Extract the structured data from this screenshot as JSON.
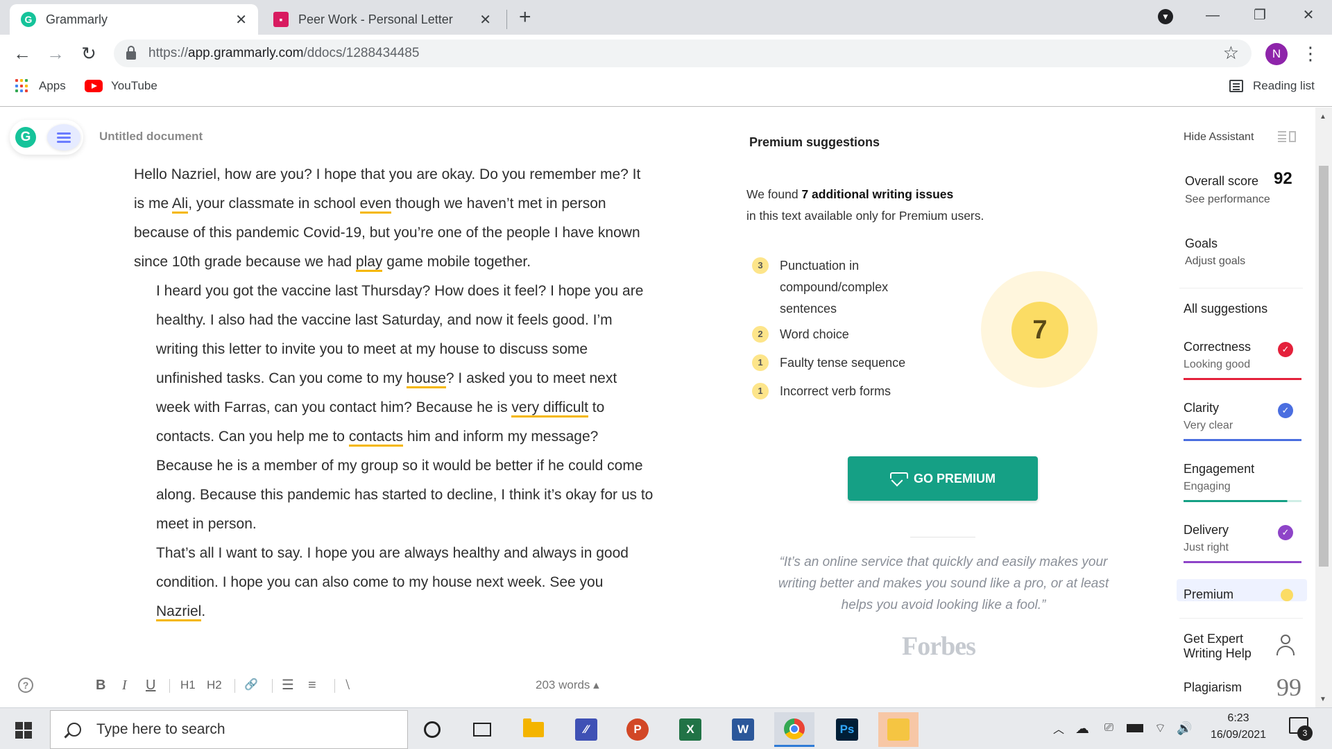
{
  "browser": {
    "tabs": [
      {
        "title": "Grammarly",
        "active": true
      },
      {
        "title": "Peer Work - Personal Letter",
        "active": false
      }
    ],
    "url_prefix": "https://",
    "url_host": "app.grammarly.com",
    "url_path": "/ddocs/1288434485",
    "profile_initial": "N",
    "bookmarks": {
      "apps": "Apps",
      "youtube": "YouTube",
      "reading_list": "Reading list"
    }
  },
  "editor": {
    "doc_title": "Untitled document",
    "paragraphs": {
      "p1": {
        "a": "Hello Nazriel, how are you? I hope that you are okay. Do you remember me? It is me ",
        "f1": "Ali",
        "b": ", your classmate in school ",
        "f2": "even",
        "c": " though we haven’t met in person because of this pandemic Covid-19, but you’re one of the people I have known since 10th grade because we had ",
        "f3": "play",
        "d": " game mobile together."
      },
      "p2": {
        "a": "I heard you got the vaccine last Thursday? How does it feel? I hope you are healthy. I also had the vaccine last Saturday, and now it feels good. I’m writing this letter to invite you to meet at my house to discuss some unfinished tasks. Can you come to my ",
        "f1": "house",
        "b": "? I asked you to meet next week with Farras, can you contact him? Because he is ",
        "f2": "very difficult",
        "c": " to contacts. Can you help me to ",
        "f3": "contacts",
        "d": " him and inform my message? Because he is a member of my group so it would be better if he could come along. Because this pandemic has started to decline, I think it’s okay for us to meet in person."
      },
      "p3": {
        "a": "That’s all I want to say. I hope you are always healthy and always in good condition. I hope you can also come to my house next week. See you ",
        "f1": "Nazriel",
        "b": "."
      }
    },
    "toolbar": {
      "bold": "B",
      "italic": "I",
      "underline": "U",
      "h1": "H1",
      "h2": "H2",
      "link": "🔗",
      "ordered": "☰",
      "bullet": "≡",
      "clear": "⧵",
      "help": "?"
    },
    "word_count": "203 words ▴"
  },
  "premium": {
    "title": "Premium suggestions",
    "found_prefix": "We found ",
    "found_bold": "7 additional writing issues",
    "found_suffix": "in this text available only for Premium users.",
    "issues": [
      {
        "count": "3",
        "label": "Punctuation in compound/complex sentences"
      },
      {
        "count": "2",
        "label": "Word choice"
      },
      {
        "count": "1",
        "label": "Faulty tense sequence"
      },
      {
        "count": "1",
        "label": "Incorrect verb forms"
      }
    ],
    "total": "7",
    "button": "GO PREMIUM",
    "quote": "“It’s an online service that quickly and easily makes your writing better and makes you sound like a pro, or at least helps you avoid looking like a fool.”",
    "source": "Forbes"
  },
  "sidebar": {
    "hide_assistant": "Hide Assistant",
    "overall_label": "Overall score",
    "overall_score": "92",
    "see_performance": "See performance",
    "goals": "Goals",
    "adjust_goals": "Adjust goals",
    "all_suggestions": "All suggestions",
    "categories": [
      {
        "name": "Correctness",
        "status": "Looking good",
        "color": "#e4213b",
        "level": 1.0
      },
      {
        "name": "Clarity",
        "status": "Very clear",
        "color": "#4a6ee0",
        "level": 1.0
      },
      {
        "name": "Engagement",
        "status": "Engaging",
        "color": "#15a085",
        "level": 0.88
      },
      {
        "name": "Delivery",
        "status": "Just right",
        "color": "#8e44c8",
        "level": 1.0
      }
    ],
    "premium": "Premium",
    "expert": "Get Expert Writing Help",
    "plagiarism": "Plagiarism"
  },
  "taskbar": {
    "search_placeholder": "Type here to search",
    "time": "6:23",
    "date": "16/09/2021",
    "notifications": "3"
  }
}
